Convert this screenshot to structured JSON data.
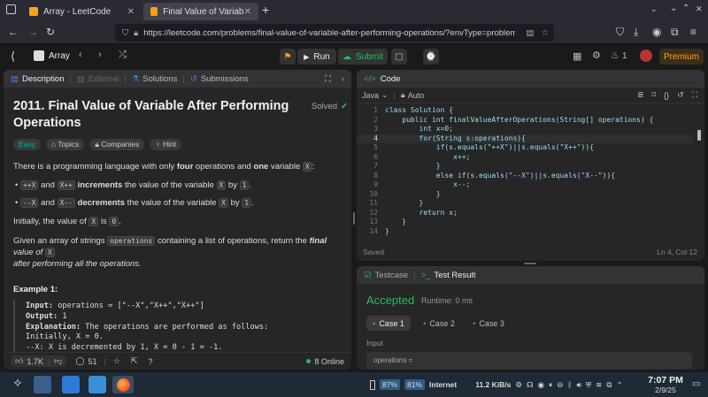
{
  "browser": {
    "tabs": [
      {
        "title": "Array - LeetCode",
        "active": false
      },
      {
        "title": "Final Value of Variable Afi",
        "active": true
      }
    ],
    "url": "https://leetcode.com/problems/final-value-of-variable-after-performing-operations/?envType=problem"
  },
  "header": {
    "problem_list": "Array",
    "run_label": "Run",
    "submit_label": "Submit",
    "streak_count": "1",
    "premium_label": "Premium"
  },
  "left_tabs": {
    "description": "Description",
    "editorial": "Editorial",
    "solutions": "Solutions",
    "submissions": "Submissions"
  },
  "problem": {
    "title": "2011. Final Value of Variable After Performing Operations",
    "status": "Solved",
    "tags": [
      "Easy",
      "Topics",
      "Companies",
      "Hint"
    ],
    "intro_pre": "There is a programming language with only ",
    "intro_b1": "four",
    "intro_mid": " operations and ",
    "intro_b2": "one",
    "intro_post": " variable ",
    "var": "X",
    "bullet1_ops": [
      "++X",
      "X++"
    ],
    "bullet1_b": "increments",
    "bullet1_text": " the value of the variable ",
    "bullet1_by": " by ",
    "bullet1_num": "1",
    "bullet2_ops": [
      "--X",
      "X--"
    ],
    "bullet2_b": "decrements",
    "and_word": "and",
    "initially_pre": "Initially, the value of ",
    "initially_is": " is ",
    "initially_val": "0",
    "given_pre": "Given an array of strings ",
    "given_code": "operations",
    "given_post": " containing a list of operations, return the ",
    "given_final": "final",
    "given_value_of": " value of ",
    "given_after": "after performing all the operations.",
    "example_title": "Example 1:",
    "example_lines": [
      {
        "label": "Input:",
        "text": " operations = [\"--X\",\"X++\",\"X++\"]"
      },
      {
        "label": "Output:",
        "text": " 1"
      },
      {
        "label": "Explanation:",
        "text": " The operations are performed as follows:"
      },
      {
        "label": "",
        "text": "Initially, X = 0."
      },
      {
        "label": "",
        "text": "--X: X is decremented by 1, X =  0 - 1 = -1."
      }
    ]
  },
  "footer": {
    "likes": "1.7K",
    "comments": "51",
    "online": "8 Online"
  },
  "code_panel": {
    "title": "Code",
    "language": "Java",
    "auto": "Auto",
    "saved": "Saved",
    "cursor": "Ln 4, Col 12",
    "lines": [
      "class Solution {",
      "    public int finalValueAfterOperations(String[] operations) {",
      "        int x=0;",
      "        for(String s:operations){",
      "            if(s.equals(\"++X\")||s.equals(\"X++\")){",
      "                x++;",
      "            }",
      "            else if(s.equals(\"--X\")||s.equals(\"X--\")){",
      "                x--;",
      "            }",
      "        }",
      "        return x;",
      "    }",
      "}"
    ]
  },
  "test_panel": {
    "testcase_tab": "Testcase",
    "result_tab": "Test Result",
    "status": "Accepted",
    "runtime": "Runtime: 0 ms",
    "cases": [
      "Case 1",
      "Case 2",
      "Case 3"
    ],
    "input_label": "Input",
    "input_value": "operations ="
  },
  "taskbar": {
    "battery1": "87%",
    "battery2": "81%",
    "network": "Internet",
    "speed": "11.2 KiB/s",
    "time": "7:07 PM",
    "date": "2/9/25"
  },
  "colors": {
    "accent_green": "#2cbb5d",
    "easy": "#00b8a3",
    "premium": "#ffa116"
  }
}
